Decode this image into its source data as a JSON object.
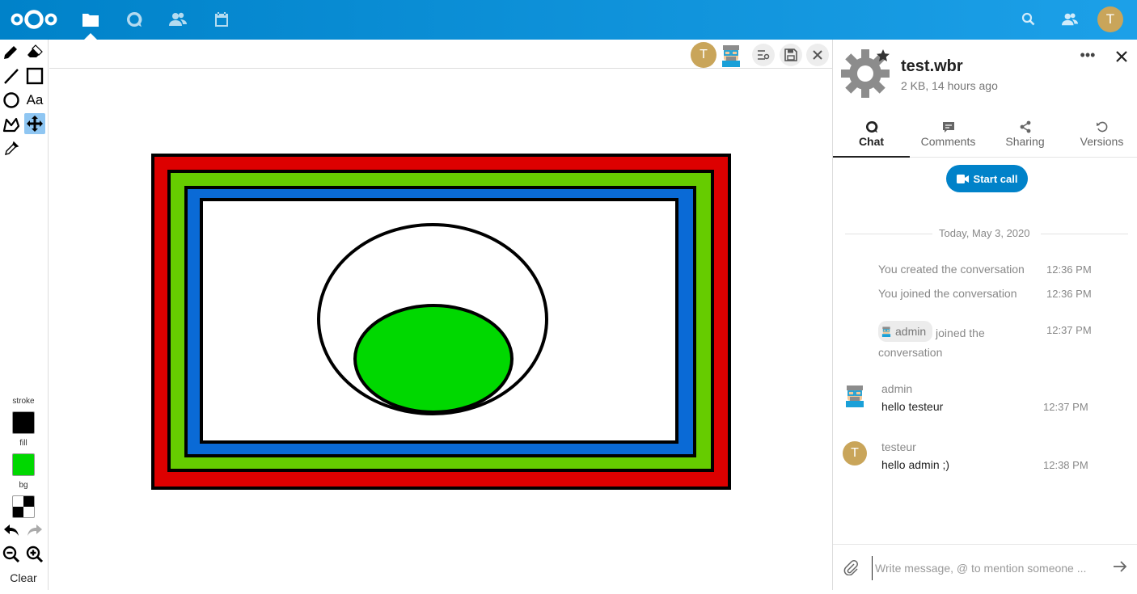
{
  "topbar": {
    "apps": [
      "files-icon",
      "talk-icon",
      "contacts-icon",
      "calendar-icon"
    ],
    "user_initial": "T",
    "user_avatar_color": "#c9a55a"
  },
  "toolbar": {
    "tools": [
      "pencil-icon",
      "eraser-icon",
      "line-icon",
      "rectangle-icon",
      "ellipse-icon",
      "text-tool",
      "polygon-icon",
      "move-icon",
      "eyedropper-icon"
    ],
    "text_tool_label": "Aa",
    "active_tool": "move-icon",
    "stroke_label": "stroke",
    "fill_label": "fill",
    "bg_label": "bg",
    "stroke_color": "#000000",
    "fill_color": "#00d800",
    "clear_label": "Clear"
  },
  "editor": {
    "participant_initial": "T",
    "participant_color": "#c9a55a"
  },
  "drawing": {
    "colors": {
      "red": "#dd0000",
      "green": "#66cc00",
      "blue": "#0a6ad6",
      "inner_fill": "#00d800"
    }
  },
  "sidebar": {
    "title": "test.wbr",
    "subtitle": "2 KB, 14 hours ago",
    "tabs": [
      {
        "label": "Chat",
        "icon": "talk-icon",
        "active": true
      },
      {
        "label": "Comments",
        "icon": "comment-icon",
        "active": false
      },
      {
        "label": "Sharing",
        "icon": "share-icon",
        "active": false
      },
      {
        "label": "Versions",
        "icon": "history-icon",
        "active": false
      }
    ],
    "start_call_label": "Start call",
    "day_separator": "Today, May 3, 2020",
    "system_messages": [
      {
        "text": "You created the conversation",
        "time": "12:36 PM"
      },
      {
        "text": "You joined the conversation",
        "time": "12:36 PM"
      },
      {
        "mention": "admin",
        "text_after": "joined the",
        "text_line2": "conversation",
        "time": "12:37 PM"
      }
    ],
    "messages": [
      {
        "author": "admin",
        "text": "hello testeur",
        "time": "12:37 PM"
      },
      {
        "author": "testeur",
        "author_initial": "T",
        "text": "hello admin ;)",
        "time": "12:38 PM"
      }
    ],
    "composer_placeholder": "Write message, @ to mention someone ..."
  }
}
